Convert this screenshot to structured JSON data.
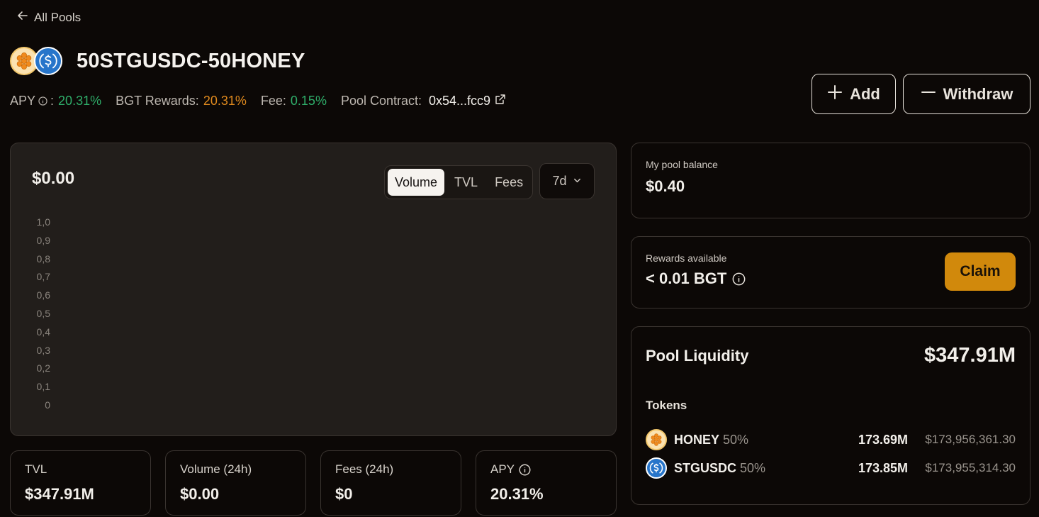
{
  "nav": {
    "back_label": "All Pools"
  },
  "pool": {
    "title": "50STGUSDC-50HONEY",
    "tokens": [
      {
        "icon": "honey-token-icon"
      },
      {
        "icon": "usdc-token-icon"
      }
    ]
  },
  "stats_row": {
    "apy_label": "APY",
    "apy_sep": ":",
    "apy_value": "20.31%",
    "bgt_label": "BGT Rewards:",
    "bgt_value": "20.31%",
    "fee_label": "Fee:",
    "fee_value": "0.15%",
    "contract_label": "Pool Contract:",
    "contract_value": "0x54...fcc9"
  },
  "actions": {
    "add_label": "Add",
    "withdraw_label": "Withdraw"
  },
  "chart": {
    "value": "$0.00",
    "tabs": [
      "Volume",
      "TVL",
      "Fees"
    ],
    "active_tab": "Volume",
    "range": "7d"
  },
  "chart_data": {
    "type": "bar",
    "categories": [],
    "values": [],
    "ylim": [
      0,
      1.0
    ],
    "yticks": [
      "1,0",
      "0,9",
      "0,8",
      "0,7",
      "0,6",
      "0,5",
      "0,4",
      "0,3",
      "0,2",
      "0,1",
      "0"
    ]
  },
  "stat_cards": [
    {
      "label": "TVL",
      "value": "$347.91M"
    },
    {
      "label": "Volume (24h)",
      "value": "$0.00"
    },
    {
      "label": "Fees (24h)",
      "value": "$0"
    },
    {
      "label": "APY",
      "value": "20.31%"
    }
  ],
  "balance": {
    "label": "My pool balance",
    "value": "$0.40"
  },
  "rewards": {
    "label": "Rewards available",
    "value": "< 0.01 BGT",
    "claim_label": "Claim"
  },
  "liquidity": {
    "label": "Pool Liquidity",
    "value": "$347.91M",
    "tokens_label": "Tokens",
    "tokens": [
      {
        "name": "HONEY",
        "pct": "50%",
        "amount": "173.69M",
        "usd": "$173,956,361.30"
      },
      {
        "name": "STGUSDC",
        "pct": "50%",
        "amount": "173.85M",
        "usd": "$173,955,314.30"
      }
    ]
  },
  "colors": {
    "accent": "#d1890c",
    "positive": "#2fae6a",
    "bgt": "#e08a1e",
    "usdc": "#2775ca"
  }
}
